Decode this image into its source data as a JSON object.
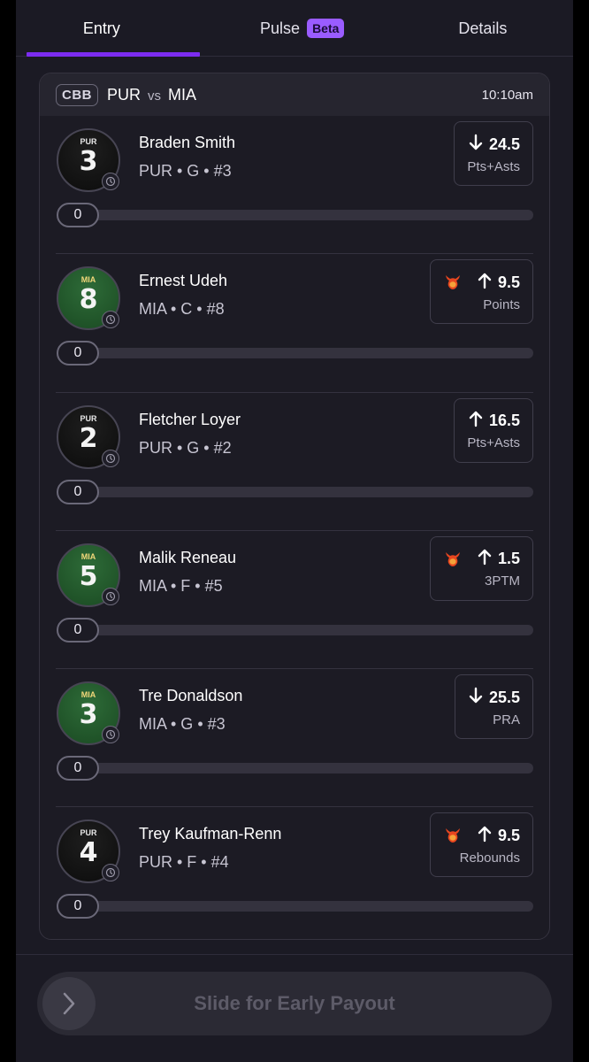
{
  "tabs": [
    {
      "label": "Entry",
      "active": true
    },
    {
      "label": "Pulse",
      "badge": "Beta"
    },
    {
      "label": "Details"
    }
  ],
  "game": {
    "league": "CBB",
    "home": "PUR",
    "vs": "vs",
    "away": "MIA",
    "time": "10:10am"
  },
  "picks": [
    {
      "name": "Braden Smith",
      "meta": "PUR • G • #3",
      "team": "PUR",
      "number": "3",
      "direction": "down",
      "line": "24.5",
      "stat": "Pts+Asts",
      "demon": false,
      "progress": "0"
    },
    {
      "name": "Ernest Udeh",
      "meta": "MIA • C • #8",
      "team": "MIA",
      "number": "8",
      "direction": "up",
      "line": "9.5",
      "stat": "Points",
      "demon": true,
      "progress": "0"
    },
    {
      "name": "Fletcher Loyer",
      "meta": "PUR • G • #2",
      "team": "PUR",
      "number": "2",
      "direction": "up",
      "line": "16.5",
      "stat": "Pts+Asts",
      "demon": false,
      "progress": "0"
    },
    {
      "name": "Malik Reneau",
      "meta": "MIA • F • #5",
      "team": "MIA",
      "number": "5",
      "direction": "up",
      "line": "1.5",
      "stat": "3PTM",
      "demon": true,
      "progress": "0"
    },
    {
      "name": "Tre Donaldson",
      "meta": "MIA • G • #3",
      "team": "MIA",
      "number": "3",
      "direction": "down",
      "line": "25.5",
      "stat": "PRA",
      "demon": false,
      "progress": "0"
    },
    {
      "name": "Trey Kaufman-Renn",
      "meta": "PUR • F • #4",
      "team": "PUR",
      "number": "4",
      "direction": "up",
      "line": "9.5",
      "stat": "Rebounds",
      "demon": true,
      "progress": "0"
    }
  ],
  "footer": {
    "slider_label": "Slide for Early Payout"
  },
  "colors": {
    "accent": "#7c2cf0",
    "beta_badge": "#9a5cff",
    "demon": "#e8461f"
  }
}
